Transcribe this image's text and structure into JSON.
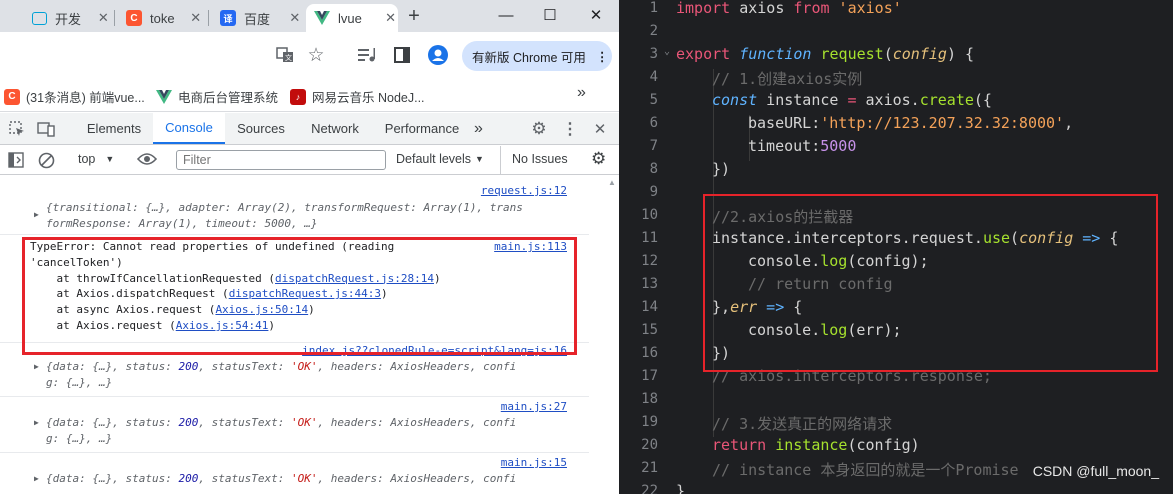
{
  "browser": {
    "tabs": [
      {
        "title": "开发",
        "icon": "bilibili-icon"
      },
      {
        "title": "toke",
        "icon": "csdn-icon"
      },
      {
        "title": "百度",
        "icon": "translate-icon"
      },
      {
        "title": "lvue",
        "icon": "vue-icon"
      }
    ],
    "new_tab": "+",
    "update_button": "有新版 Chrome 可用",
    "bookmarks": [
      {
        "label": "(31条消息) 前端vue...",
        "icon": "csdn-icon"
      },
      {
        "label": "电商后台管理系统",
        "icon": "vue-icon"
      },
      {
        "label": "网易云音乐 NodeJ...",
        "icon": "netease-icon"
      }
    ],
    "bookmarks_more": "»"
  },
  "devtools": {
    "tabs": [
      "Elements",
      "Console",
      "Sources",
      "Network",
      "Performance"
    ],
    "more_tabs": "»",
    "context": "top",
    "filter_placeholder": "Filter",
    "levels": "Default levels",
    "issues": "No Issues"
  },
  "console": {
    "entries": [
      {
        "source": "request.js:12",
        "line1": "{transitional: {…}, adapter: Array(2), transformRequest: Array(1), trans",
        "line2": "formResponse: Array(1), timeout: 5000, …}"
      },
      {
        "source": "main.js:113",
        "error_lines": [
          "TypeError: Cannot read properties of undefined (reading",
          "'cancelToken')"
        ],
        "stack": [
          {
            "prefix": "    at throwIfCancellationRequested (",
            "link": "dispatchRequest.js:28:14",
            "suffix": ")"
          },
          {
            "prefix": "    at Axios.dispatchRequest (",
            "link": "dispatchRequest.js:44:3",
            "suffix": ")"
          },
          {
            "prefix": "    at async Axios.request (",
            "link": "Axios.js:50:14",
            "suffix": ")"
          },
          {
            "prefix": "    at Axios.request (",
            "link": "Axios.js:54:41",
            "suffix": ")"
          }
        ]
      },
      {
        "source": "index.js??clonedRule-e=script&lang=js:16",
        "line1": "{data: {…}, status: 200, statusText: 'OK', headers: AxiosHeaders, confi",
        "line2": "g: {…}, …}"
      },
      {
        "source": "main.js:27",
        "line1": "{data: {…}, status: 200, statusText: 'OK', headers: AxiosHeaders, confi",
        "line2": "g: {…}, …}"
      },
      {
        "source": "main.js:15",
        "line1": "{data: {…}, status: 200, statusText: 'OK', headers: AxiosHeaders, confi",
        "line2": ""
      }
    ]
  },
  "editor": {
    "line_numbers": [
      "1",
      "2",
      "3",
      "4",
      "5",
      "6",
      "7",
      "8",
      "9",
      "10",
      "11",
      "12",
      "13",
      "14",
      "15",
      "16",
      "17",
      "18",
      "19",
      "20",
      "21",
      "22"
    ],
    "lines": {
      "l1": {
        "kw": "import",
        "a": " axios ",
        "kw2": "from",
        "str": " 'axios'"
      },
      "l3": {
        "kw": "export",
        "fnkw": " function",
        "fn": " request",
        "p1": "(",
        "par": "config",
        "p2": ") {"
      },
      "l4": "// 1.创建axios实例",
      "l5": {
        "kw": "const",
        "a": " instance ",
        "op": "=",
        "b": " axios.",
        "fn": "create",
        "c": "({"
      },
      "l6": {
        "a": "baseURL:",
        "str": "'http://123.207.32.32:8000'",
        "c": ","
      },
      "l7": {
        "a": "timeout:",
        "num": "5000"
      },
      "l8": "})",
      "l10": "//2.axios的拦截器",
      "l11": {
        "a": "instance.interceptors.request.",
        "fn": "use",
        "b": "(",
        "par": "config",
        "arrow": " =>",
        "c": " {"
      },
      "l12": {
        "a": "console.",
        "fn": "log",
        "b": "(config);"
      },
      "l13": "// return config",
      "l14": {
        "a": "},",
        "par": "err",
        "arrow": " =>",
        "c": " {"
      },
      "l15": {
        "a": "console.",
        "fn": "log",
        "b": "(err);"
      },
      "l16": "})",
      "l17": "// axios.interceptors.response;",
      "l19": "// 3.发送真正的网络请求",
      "l20": {
        "kw": "return",
        "fn": " instance",
        "b": "(config)"
      },
      "l21": "// instance 本身返回的就是一个Promise",
      "l22": "}"
    }
  },
  "watermark": "CSDN @full_moon_",
  "colors": {
    "highlight_box": "#e6232a",
    "chrome_blue": "#1a73e8",
    "editor_bg": "#1e1f22"
  }
}
